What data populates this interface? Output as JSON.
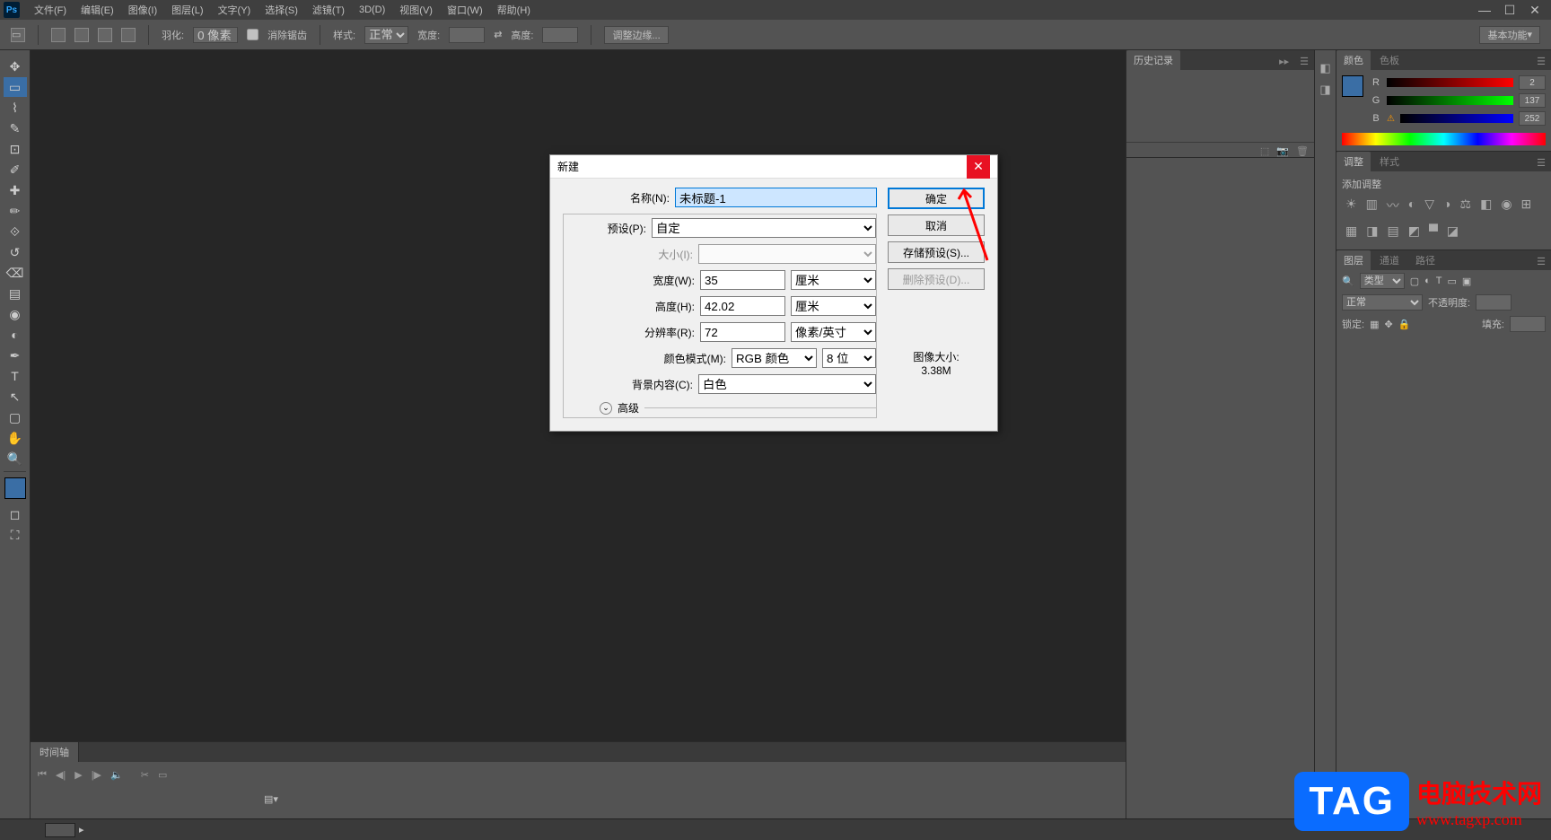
{
  "titlebar": {
    "menus": {
      "file": "文件(F)",
      "edit": "编辑(E)",
      "image": "图像(I)",
      "layer": "图层(L)",
      "type": "文字(Y)",
      "select": "选择(S)",
      "filter": "滤镜(T)",
      "3d": "3D(D)",
      "view": "视图(V)",
      "window": "窗口(W)",
      "help": "帮助(H)"
    },
    "logo": "Ps"
  },
  "options_bar": {
    "feather_label": "羽化:",
    "feather_value": "0 像素",
    "antialias_label": "消除锯齿",
    "style_label": "样式:",
    "style_value": "正常",
    "width_label": "宽度:",
    "height_label": "高度:",
    "refine_edge": "调整边缘...",
    "workspace": "基本功能"
  },
  "panels": {
    "history": "历史记录",
    "color": "颜色",
    "swatches": "色板",
    "adjustments": "调整",
    "styles": "样式",
    "add_adjustment": "添加调整",
    "layers": "图层",
    "channels": "通道",
    "paths": "路径",
    "layer_kind": "类型",
    "blend_mode": "正常",
    "opacity_label": "不透明度:",
    "lock_label": "锁定:",
    "fill_label": "填充:",
    "timeline": "时间轴",
    "rgb_r": "R",
    "rgb_g": "G",
    "rgb_b": "B",
    "rgb_r_val": "2",
    "rgb_g_val": "137",
    "rgb_b_val": "252"
  },
  "dialog": {
    "title": "新建",
    "name_label": "名称(N):",
    "name_value": "未标题-1",
    "preset_label": "预设(P):",
    "preset_value": "自定",
    "size_label": "大小(I):",
    "width_label": "宽度(W):",
    "width_value": "35",
    "width_unit": "厘米",
    "height_label": "高度(H):",
    "height_value": "42.02",
    "height_unit": "厘米",
    "resolution_label": "分辨率(R):",
    "resolution_value": "72",
    "resolution_unit": "像素/英寸",
    "color_mode_label": "颜色模式(M):",
    "color_mode_value": "RGB 颜色",
    "color_depth": "8 位",
    "bg_label": "背景内容(C):",
    "bg_value": "白色",
    "advanced": "高级",
    "ok": "确定",
    "cancel": "取消",
    "save_preset": "存储预设(S)...",
    "delete_preset": "删除预设(D)...",
    "image_size_label": "图像大小:",
    "image_size_value": "3.38M"
  },
  "watermark": {
    "badge": "TAG",
    "cn": "电脑技术网",
    "url": "www.tagxp.com"
  }
}
